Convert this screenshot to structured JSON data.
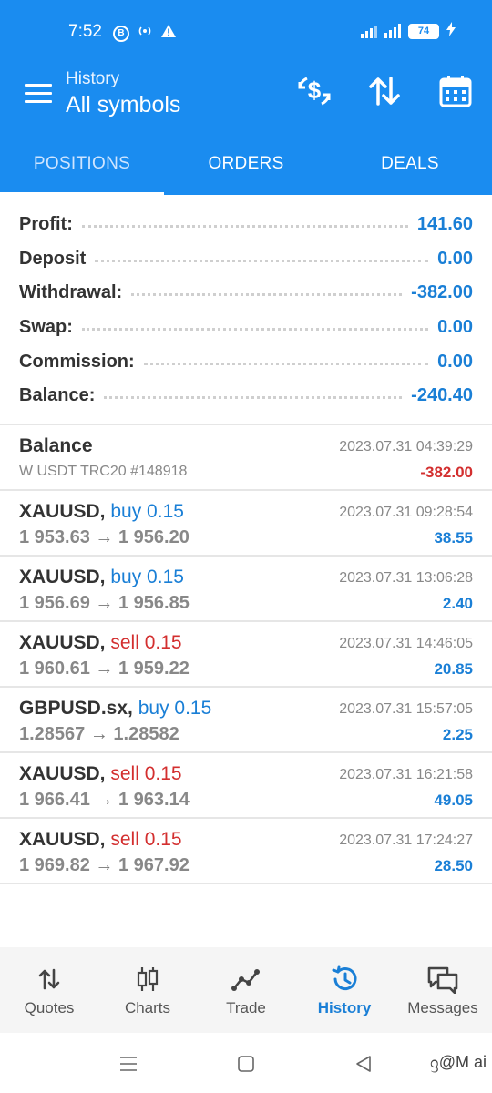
{
  "status_bar": {
    "time": "7:52",
    "battery": "74"
  },
  "header": {
    "subtitle": "History",
    "title": "All symbols"
  },
  "tabs": [
    {
      "label": "POSITIONS",
      "active": true
    },
    {
      "label": "ORDERS",
      "active": false
    },
    {
      "label": "DEALS",
      "active": false
    }
  ],
  "summary": [
    {
      "label": "Profit:",
      "value": "141.60"
    },
    {
      "label": "Deposit",
      "value": "0.00"
    },
    {
      "label": "Withdrawal:",
      "value": "-382.00"
    },
    {
      "label": "Swap:",
      "value": "0.00"
    },
    {
      "label": "Commission:",
      "value": "0.00"
    },
    {
      "label": "Balance:",
      "value": "-240.40"
    }
  ],
  "balance_entry": {
    "title": "Balance",
    "comment": "W USDT TRC20 #148918",
    "datetime": "2023.07.31 04:39:29",
    "amount": "-382.00"
  },
  "positions": [
    {
      "symbol": "XAUUSD,",
      "side": "buy 0.15",
      "direction": "buy",
      "open": "1 953.63",
      "close": "1 956.20",
      "datetime": "2023.07.31 09:28:54",
      "profit": "38.55"
    },
    {
      "symbol": "XAUUSD,",
      "side": "buy 0.15",
      "direction": "buy",
      "open": "1 956.69",
      "close": "1 956.85",
      "datetime": "2023.07.31 13:06:28",
      "profit": "2.40"
    },
    {
      "symbol": "XAUUSD,",
      "side": "sell 0.15",
      "direction": "sell",
      "open": "1 960.61",
      "close": "1 959.22",
      "datetime": "2023.07.31 14:46:05",
      "profit": "20.85"
    },
    {
      "symbol": "GBPUSD.sx,",
      "side": "buy 0.15",
      "direction": "buy",
      "open": "1.28567",
      "close": "1.28582",
      "datetime": "2023.07.31 15:57:05",
      "profit": "2.25"
    },
    {
      "symbol": "XAUUSD,",
      "side": "sell 0.15",
      "direction": "sell",
      "open": "1 966.41",
      "close": "1 963.14",
      "datetime": "2023.07.31 16:21:58",
      "profit": "49.05"
    },
    {
      "symbol": "XAUUSD,",
      "side": "sell 0.15",
      "direction": "sell",
      "open": "1 969.82",
      "close": "1 967.92",
      "datetime": "2023.07.31 17:24:27",
      "profit": "28.50"
    }
  ],
  "arrow_glyph": "→",
  "bottom_nav": [
    {
      "label": "Quotes",
      "icon": "quotes-icon",
      "active": false
    },
    {
      "label": "Charts",
      "icon": "charts-icon",
      "active": false
    },
    {
      "label": "Trade",
      "icon": "trade-icon",
      "active": false
    },
    {
      "label": "History",
      "icon": "history-icon",
      "active": true
    },
    {
      "label": "Messages",
      "icon": "messages-icon",
      "active": false
    }
  ],
  "watermark": "ᦋ@M ai",
  "colors": {
    "primary": "#1a8cf0",
    "value_blue": "#1a7fd6",
    "sell_red": "#d32f2f"
  }
}
